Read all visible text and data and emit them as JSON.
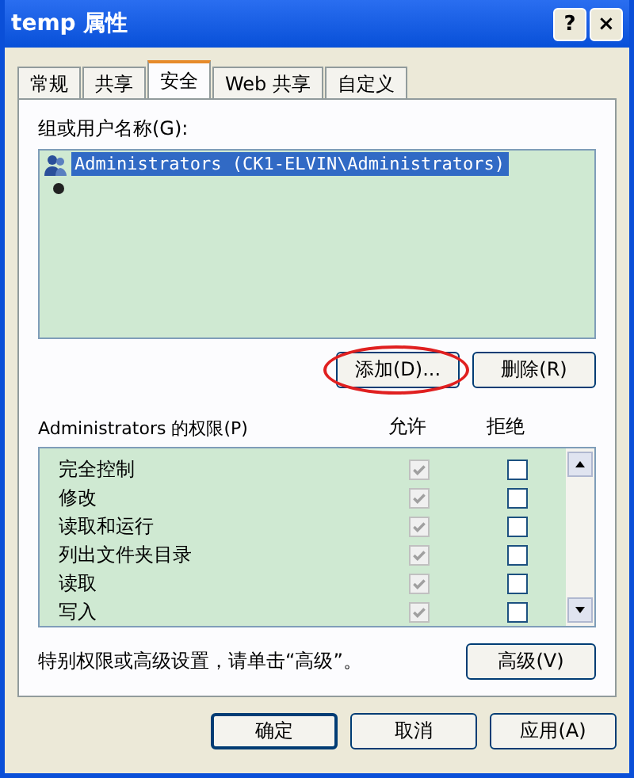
{
  "window": {
    "title": "temp 属性",
    "buttons": [
      "?",
      "×"
    ]
  },
  "tabs": [
    {
      "label": "常规",
      "selected": false
    },
    {
      "label": "共享",
      "selected": false
    },
    {
      "label": "安全",
      "selected": true
    },
    {
      "label": "Web 共享",
      "selected": false
    },
    {
      "label": "自定义",
      "selected": false
    }
  ],
  "users": {
    "label": "组或用户名称(G):",
    "items": [
      {
        "name": "Administrators (CK1-ELVIN\\Administrators)",
        "selected": true
      }
    ]
  },
  "user_buttons": [
    {
      "label": "添加(D)...",
      "highlighted": true
    },
    {
      "label": "删除(R)",
      "highlighted": false
    }
  ],
  "permissions": {
    "label": "Administrators 的权限(P)",
    "columns": [
      "允许",
      "拒绝"
    ],
    "rows": [
      {
        "name": "完全控制",
        "allow": {
          "checked": true,
          "disabled": true
        },
        "deny": {
          "checked": false,
          "disabled": false
        }
      },
      {
        "name": "修改",
        "allow": {
          "checked": true,
          "disabled": true
        },
        "deny": {
          "checked": false,
          "disabled": false
        }
      },
      {
        "name": "读取和运行",
        "allow": {
          "checked": true,
          "disabled": true
        },
        "deny": {
          "checked": false,
          "disabled": false
        }
      },
      {
        "name": "列出文件夹目录",
        "allow": {
          "checked": true,
          "disabled": true
        },
        "deny": {
          "checked": false,
          "disabled": false
        }
      },
      {
        "name": "读取",
        "allow": {
          "checked": true,
          "disabled": true
        },
        "deny": {
          "checked": false,
          "disabled": false
        }
      },
      {
        "name": "写入",
        "allow": {
          "checked": true,
          "disabled": true
        },
        "deny": {
          "checked": false,
          "disabled": false
        }
      }
    ]
  },
  "advanced": {
    "note": "特别权限或高级设置，请单击“高级”。",
    "button": "高级(V)"
  },
  "footer_buttons": [
    "确定",
    "取消",
    "应用(A)"
  ]
}
